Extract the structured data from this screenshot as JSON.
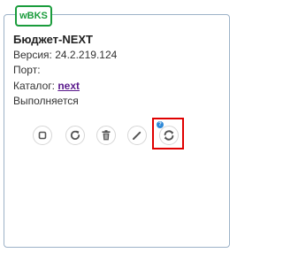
{
  "card": {
    "badge": "wBKS",
    "title": "Бюджет-NEXT",
    "version_label": "Версия:",
    "version_value": "24.2.219.124",
    "port_label": "Порт:",
    "catalog_label": "Каталог:",
    "catalog_link": "next",
    "status": "Выполняется"
  },
  "actions": [
    {
      "name": "stop",
      "icon": "stop-icon"
    },
    {
      "name": "restart",
      "icon": "restart-icon"
    },
    {
      "name": "delete",
      "icon": "trash-icon"
    },
    {
      "name": "edit",
      "icon": "pencil-icon"
    },
    {
      "name": "update",
      "icon": "sync-icon"
    }
  ],
  "colors": {
    "badge_green": "#1a9c3c",
    "link_purple": "#5a1a8c",
    "highlight_red": "#e00000",
    "notify_blue": "#2f8ad8"
  }
}
